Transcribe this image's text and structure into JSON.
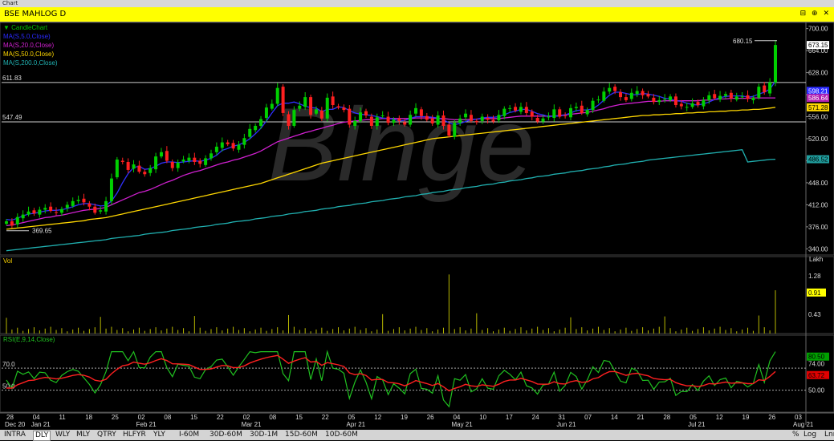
{
  "window_title": "Chart",
  "symbol": "BSE MAHLOG D",
  "header_icons": "⊟ ⊕ ✕",
  "main_legend": [
    {
      "label": "CandleChart",
      "color": "#00c000"
    },
    {
      "label": "MA(S,5.0,Close)",
      "color": "#2a2aff"
    },
    {
      "label": "MA(S,20.0,Close)",
      "color": "#d020d0"
    },
    {
      "label": "MA(S,50.0,Close)",
      "color": "#ffd700"
    },
    {
      "label": "MA(S,200.0,Close)",
      "color": "#20b0b0"
    }
  ],
  "vol_label": "Vol",
  "vol_unit": "Lakh",
  "rsi_label": "RSI(E,9,14,Close)",
  "watermark": "Binge",
  "annotations": {
    "high_label": "680.15",
    "low_label": "369.65",
    "hline1": "611.83",
    "hline2": "547.49",
    "rsi70": "70.0",
    "rsi50": "50.0"
  },
  "price_axis": [
    "700.00",
    "664.00",
    "628.00",
    "592.00",
    "556.00",
    "520.00",
    "484.00",
    "448.00",
    "412.00",
    "376.00",
    "340.00"
  ],
  "price_badges": [
    {
      "text": "673.15",
      "bg": "#ffffff",
      "fg": "#000000"
    },
    {
      "text": "598.21",
      "bg": "#2a2aff",
      "fg": "#ffffff"
    },
    {
      "text": "586.64",
      "bg": "#b020b0",
      "fg": "#ffffff"
    },
    {
      "text": "571.28",
      "bg": "#ffd700",
      "fg": "#000000"
    },
    {
      "text": "486.52",
      "bg": "#20a0a0",
      "fg": "#000000"
    }
  ],
  "vol_axis": [
    "1.28",
    "0.43"
  ],
  "vol_badge": {
    "text": "0.91",
    "bg": "#ffff00",
    "fg": "#000"
  },
  "rsi_axis": [
    "74.00",
    "50.00"
  ],
  "rsi_badges": [
    {
      "text": "80.50",
      "bg": "#00a000",
      "fg": "#000"
    },
    {
      "text": "63.72",
      "bg": "#e00000",
      "fg": "#000"
    }
  ],
  "date_labels": [
    {
      "d": "28",
      "m": "Dec 20"
    },
    {
      "d": "04",
      "m": "Jan 21"
    },
    {
      "d": "11",
      "m": ""
    },
    {
      "d": "18",
      "m": ""
    },
    {
      "d": "25",
      "m": ""
    },
    {
      "d": "02",
      "m": "Feb 21"
    },
    {
      "d": "08",
      "m": ""
    },
    {
      "d": "15",
      "m": ""
    },
    {
      "d": "22",
      "m": ""
    },
    {
      "d": "02",
      "m": "Mar 21"
    },
    {
      "d": "08",
      "m": ""
    },
    {
      "d": "15",
      "m": ""
    },
    {
      "d": "22",
      "m": ""
    },
    {
      "d": "05",
      "m": "Apr 21"
    },
    {
      "d": "12",
      "m": ""
    },
    {
      "d": "19",
      "m": ""
    },
    {
      "d": "26",
      "m": ""
    },
    {
      "d": "04",
      "m": "May 21"
    },
    {
      "d": "10",
      "m": ""
    },
    {
      "d": "17",
      "m": ""
    },
    {
      "d": "24",
      "m": ""
    },
    {
      "d": "31",
      "m": "Jun 21"
    },
    {
      "d": "07",
      "m": ""
    },
    {
      "d": "14",
      "m": ""
    },
    {
      "d": "21",
      "m": ""
    },
    {
      "d": "28",
      "m": ""
    },
    {
      "d": "05",
      "m": "Jul 21"
    },
    {
      "d": "12",
      "m": ""
    },
    {
      "d": "19",
      "m": ""
    },
    {
      "d": "26",
      "m": ""
    },
    {
      "d": "03",
      "m": "Aug 21"
    }
  ],
  "bottom_left": [
    "INTRA",
    "DLY",
    "WLY",
    "MLY",
    "QTRY",
    "HLFYR",
    "YLY"
  ],
  "bottom_active": "DLY",
  "bottom_mid": [
    "I-60M",
    "30D-60M",
    "30D-1M",
    "15D-60M",
    "10D-60M"
  ],
  "bottom_right": [
    "%",
    "Log",
    "Lnr"
  ],
  "chart_data": {
    "type": "candlestick",
    "ylim": [
      330,
      710
    ],
    "closes": [
      385,
      378,
      392,
      396,
      401,
      398,
      404,
      407,
      402,
      399,
      405,
      412,
      418,
      420,
      416,
      409,
      399,
      403,
      418,
      455,
      486,
      482,
      469,
      478,
      466,
      462,
      472,
      491,
      498,
      484,
      472,
      481,
      486,
      489,
      482,
      479,
      488,
      496,
      507,
      514,
      511,
      504,
      510,
      521,
      536,
      541,
      552,
      571,
      577,
      603,
      562,
      541,
      567,
      574,
      588,
      559,
      568,
      553,
      587,
      575,
      571,
      567,
      543,
      549,
      563,
      558,
      541,
      555,
      558,
      546,
      551,
      549,
      543,
      559,
      570,
      557,
      551,
      545,
      558,
      541,
      525,
      546,
      553,
      561,
      549,
      547,
      556,
      551,
      548,
      559,
      569,
      570,
      566,
      572,
      562,
      556,
      548,
      553,
      556,
      568,
      556,
      557,
      570,
      572,
      562,
      567,
      582,
      584,
      597,
      603,
      598,
      588,
      583,
      595,
      598,
      591,
      589,
      580,
      583,
      585,
      589,
      575,
      573,
      572,
      578,
      575,
      583,
      591,
      586,
      590,
      593,
      586,
      589,
      589,
      585,
      587,
      605,
      596,
      612,
      673.15
    ],
    "ma5": [
      388,
      387,
      390,
      394,
      397,
      398,
      400,
      402,
      403,
      403,
      404,
      406,
      409,
      412,
      414,
      414,
      412,
      410,
      411,
      418,
      431,
      448,
      463,
      473,
      475,
      470,
      471,
      475,
      480,
      482,
      482,
      481,
      482,
      483,
      484,
      483,
      485,
      488,
      493,
      501,
      504,
      508,
      510,
      514,
      520,
      528,
      537,
      549,
      562,
      574,
      578,
      578,
      580,
      577,
      573,
      571,
      570,
      564,
      568,
      568,
      572,
      571,
      566,
      562,
      560,
      559,
      558,
      556,
      554,
      553,
      552,
      549,
      550,
      553,
      556,
      556,
      556,
      555,
      554,
      551,
      546,
      543,
      545,
      548,
      551,
      552,
      554,
      555,
      555,
      556,
      559,
      563,
      565,
      568,
      568,
      565,
      561,
      559,
      556,
      557,
      557,
      559,
      562,
      566,
      567,
      567,
      569,
      575,
      583,
      591,
      596,
      596,
      594,
      592,
      592,
      594,
      593,
      591,
      589,
      586,
      585,
      582,
      581,
      578,
      576,
      575,
      577,
      580,
      584,
      587,
      589,
      590,
      590,
      590,
      588,
      589,
      593,
      596,
      601,
      614
    ],
    "ma20": [
      378,
      379,
      381,
      383,
      385,
      387,
      389,
      391,
      392,
      394,
      395,
      397,
      399,
      401,
      403,
      404,
      405,
      406,
      408,
      412,
      416,
      420,
      424,
      428,
      432,
      434,
      437,
      441,
      445,
      449,
      452,
      456,
      460,
      463,
      466,
      468,
      471,
      474,
      477,
      480,
      482,
      485,
      487,
      490,
      493,
      496,
      500,
      505,
      510,
      515,
      518,
      521,
      524,
      527,
      530,
      532,
      535,
      537,
      540,
      542,
      545,
      547,
      548,
      549,
      550,
      551,
      551,
      552,
      553,
      553,
      553,
      553,
      553,
      553,
      554,
      554,
      554,
      554,
      553,
      553,
      552,
      551,
      551,
      551,
      552,
      552,
      553,
      553,
      553,
      553,
      554,
      555,
      556,
      557,
      557,
      557,
      557,
      557,
      557,
      557,
      558,
      559,
      560,
      561,
      562,
      563,
      565,
      567,
      569,
      572,
      574,
      576,
      577,
      578,
      579,
      580,
      581,
      581,
      581,
      582,
      582,
      582,
      582,
      582,
      582,
      582,
      583,
      583,
      584,
      585,
      585,
      586,
      586,
      586,
      586,
      586.64,
      586.64,
      586.64,
      586.64,
      586.64
    ],
    "ma50": [
      372,
      373,
      374,
      375,
      376,
      377,
      378,
      379,
      380,
      381,
      382,
      383,
      384,
      385,
      386,
      388,
      389,
      390,
      391,
      393,
      395,
      397,
      399,
      401,
      403,
      405,
      407,
      409,
      411,
      413,
      415,
      417,
      419,
      421,
      423,
      425,
      427,
      429,
      431,
      433,
      435,
      437,
      439,
      441,
      443,
      445,
      447,
      450,
      453,
      456,
      459,
      462,
      465,
      468,
      471,
      474,
      477,
      480,
      482,
      484,
      486,
      488,
      490,
      492,
      494,
      496,
      498,
      500,
      502,
      504,
      506,
      508,
      510,
      512,
      514,
      516,
      518,
      520,
      521,
      522,
      523,
      524,
      525,
      526,
      527,
      528,
      529,
      530,
      531,
      532,
      533,
      534,
      535,
      536,
      537,
      538,
      539,
      540,
      541,
      542,
      543,
      544,
      545,
      546,
      547,
      548,
      549,
      550,
      551,
      552,
      553,
      554,
      555,
      556,
      557,
      558,
      558,
      559,
      559,
      560,
      560,
      561,
      561,
      562,
      562,
      563,
      563,
      564,
      564,
      565,
      565,
      566,
      566,
      567,
      567,
      568,
      568,
      569,
      570,
      571.28
    ],
    "ma200": [
      337,
      338,
      339,
      340,
      341,
      342,
      343,
      344,
      345,
      346,
      347,
      348,
      349,
      350,
      351,
      352,
      353,
      354,
      355,
      357,
      358,
      359,
      360,
      361,
      362,
      364,
      365,
      366,
      367,
      368,
      370,
      371,
      372,
      373,
      375,
      376,
      377,
      378,
      380,
      381,
      382,
      384,
      385,
      386,
      387,
      389,
      390,
      391,
      393,
      394,
      395,
      397,
      398,
      399,
      401,
      402,
      403,
      405,
      406,
      407,
      409,
      410,
      411,
      413,
      414,
      415,
      417,
      418,
      419,
      421,
      422,
      423,
      425,
      426,
      427,
      429,
      430,
      432,
      433,
      434,
      436,
      437,
      438,
      440,
      441,
      442,
      444,
      445,
      446,
      448,
      449,
      451,
      452,
      453,
      455,
      456,
      458,
      459,
      460,
      462,
      463,
      464,
      466,
      467,
      468,
      470,
      471,
      472,
      474,
      475,
      477,
      478,
      479,
      481,
      482,
      483,
      485,
      486,
      487,
      488,
      489,
      490,
      491,
      492,
      493,
      494,
      495,
      496,
      497,
      498,
      499,
      500,
      501,
      502,
      482,
      483,
      484,
      485,
      486,
      486.52
    ],
    "volume_ylim": [
      0,
      1.6
    ],
    "rsi_ylim": [
      30,
      100
    ]
  }
}
